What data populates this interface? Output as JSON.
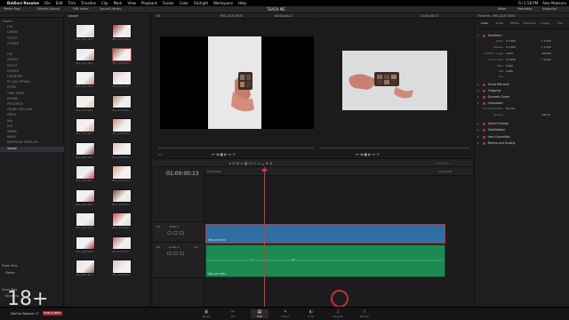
{
  "menubar": {
    "app": "DaVinci Resolve",
    "items": [
      "File",
      "Edit",
      "Trim",
      "Timeline",
      "Clip",
      "Mark",
      "View",
      "Playback",
      "Fusion",
      "Color",
      "Fairlight",
      "Workspace",
      "Help"
    ],
    "user": "Alex Makarov",
    "clock": "Fri 1:58 PM"
  },
  "toolbar": {
    "media_pool": "Media Pool",
    "effects": "Effects Library",
    "edit_index": "Edit Index",
    "sound_library": "Sound Library",
    "project_title": "TEACH ME",
    "mixer": "Mixer",
    "metadata": "Metadata",
    "inspector": "Inspector"
  },
  "bins": {
    "header": "iphone",
    "rows": [
      "Master",
      "FOX",
      "CANON",
      "PHOTO",
      "STOKED",
      "",
      "FOX",
      "CANON",
      "PHOTO",
      "STOKED",
      "FIREWORK",
      "PS LED OPTIMAL",
      "ZOOM",
      "TRAIL HERO",
      "IPHONE",
      "PHOTOBOX",
      "PHONE CIRCULAR",
      "PRESS",
      "JAW",
      "HOT",
      "AMBEE",
      "RADIO",
      "INTERVIEW TEMPLATE",
      "iphone"
    ],
    "power_bins": "Power Bins",
    "smart_bins": "Smart Bins",
    "master_label": "Master",
    "keywords": "Keywords"
  },
  "clips": [
    "IMG_0251.MOV",
    "IMG_0251.MOV",
    "IMG_0247.MOV",
    "IMG_0248.MOV",
    "IMG_0249.MOV",
    "IMG_0252.MOV",
    "IMG_0253.MOV",
    "IMG_0254.MOV",
    "IMG_0255.MOV",
    "IMG_0256.MOV",
    "IMG_0257.MOV",
    "IMG_0258.MOV",
    "IMG_0259.MOV",
    "IMG_0260.MOV",
    "IMG_0261.MOV",
    "IMG_0262.MOV",
    "IMG_0263.MOV",
    "IMG_0264.MOV",
    "IMG_0265.MOV",
    "IMG_0266.MOV",
    "IMG_0267.MOV",
    "IMG_0268.MOV"
  ],
  "source_viewer": {
    "zoom": "Fit",
    "clip": "IMG_0247.MOV",
    "tc_left": "00:00:00:22",
    "tc_right": "00:00:01:03"
  },
  "program_viewer": {
    "tc": "01:00:00:13",
    "timeline": "Timeline - IMG_0247.MOV"
  },
  "timeline": {
    "timecode": "01:00:00:13",
    "video_track": "Video 1",
    "audio_track": "Audio 1",
    "audio_level": "2.0",
    "clip_name": "IMG_0247.MOV",
    "ruler_start": "01:00:00:00",
    "ruler_end": "01:00:12:00"
  },
  "inspector": {
    "title": "Timeline - IMG_0247.MOV",
    "tabs": [
      "Video",
      "Audio",
      "Effects",
      "Transition",
      "Image",
      "File"
    ],
    "sections": [
      "Transform",
      "Smart Reframe",
      "Cropping",
      "Dynamic Zoom",
      "Composite",
      "Speed Change",
      "Stabilization",
      "Lens Correction",
      "Retime and Scaling"
    ],
    "props": [
      {
        "label": "Zoom",
        "x": "X 1.000",
        "y": "Y 1.000"
      },
      {
        "label": "Position",
        "x": "X 0.000",
        "y": "Y 0.000"
      },
      {
        "label": "Rotation Angle",
        "x": "0.000",
        "y": "-90.000"
      },
      {
        "label": "Anchor Point",
        "x": "X 0.000",
        "y": "Y 0.000"
      },
      {
        "label": "Pitch",
        "x": "0.000",
        "y": ""
      },
      {
        "label": "Yaw",
        "x": "0.000",
        "y": ""
      },
      {
        "label": "Flip",
        "x": "",
        "y": ""
      }
    ],
    "composite_mode": "Normal",
    "composite_label": "Composite Mode",
    "opacity_label": "Opacity",
    "opacity": "100.00"
  },
  "pages": [
    "Media",
    "Cut",
    "Edit",
    "Fusion",
    "Color",
    "Fairlight",
    "Deliver"
  ],
  "active_page": "Edit",
  "watermark": "18+",
  "brand": {
    "name": "DaVinci Resolve 17",
    "badge": "PUBLIC BETA"
  },
  "colors": {
    "playhead": "#dd3333",
    "video_clip": "#2f6ea3",
    "audio_clip": "#1d8a52",
    "accent": "#c0333a"
  }
}
